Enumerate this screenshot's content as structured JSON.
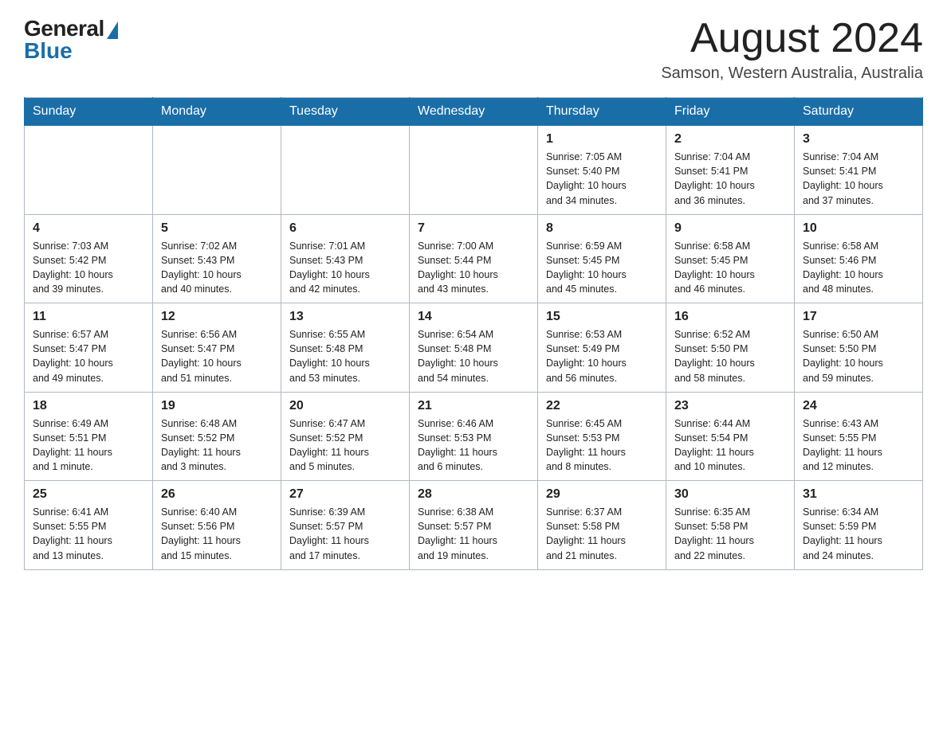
{
  "header": {
    "logo_general": "General",
    "logo_blue": "Blue",
    "month_year": "August 2024",
    "location": "Samson, Western Australia, Australia"
  },
  "days_of_week": [
    "Sunday",
    "Monday",
    "Tuesday",
    "Wednesday",
    "Thursday",
    "Friday",
    "Saturday"
  ],
  "weeks": [
    [
      {
        "day": "",
        "info": ""
      },
      {
        "day": "",
        "info": ""
      },
      {
        "day": "",
        "info": ""
      },
      {
        "day": "",
        "info": ""
      },
      {
        "day": "1",
        "info": "Sunrise: 7:05 AM\nSunset: 5:40 PM\nDaylight: 10 hours\nand 34 minutes."
      },
      {
        "day": "2",
        "info": "Sunrise: 7:04 AM\nSunset: 5:41 PM\nDaylight: 10 hours\nand 36 minutes."
      },
      {
        "day": "3",
        "info": "Sunrise: 7:04 AM\nSunset: 5:41 PM\nDaylight: 10 hours\nand 37 minutes."
      }
    ],
    [
      {
        "day": "4",
        "info": "Sunrise: 7:03 AM\nSunset: 5:42 PM\nDaylight: 10 hours\nand 39 minutes."
      },
      {
        "day": "5",
        "info": "Sunrise: 7:02 AM\nSunset: 5:43 PM\nDaylight: 10 hours\nand 40 minutes."
      },
      {
        "day": "6",
        "info": "Sunrise: 7:01 AM\nSunset: 5:43 PM\nDaylight: 10 hours\nand 42 minutes."
      },
      {
        "day": "7",
        "info": "Sunrise: 7:00 AM\nSunset: 5:44 PM\nDaylight: 10 hours\nand 43 minutes."
      },
      {
        "day": "8",
        "info": "Sunrise: 6:59 AM\nSunset: 5:45 PM\nDaylight: 10 hours\nand 45 minutes."
      },
      {
        "day": "9",
        "info": "Sunrise: 6:58 AM\nSunset: 5:45 PM\nDaylight: 10 hours\nand 46 minutes."
      },
      {
        "day": "10",
        "info": "Sunrise: 6:58 AM\nSunset: 5:46 PM\nDaylight: 10 hours\nand 48 minutes."
      }
    ],
    [
      {
        "day": "11",
        "info": "Sunrise: 6:57 AM\nSunset: 5:47 PM\nDaylight: 10 hours\nand 49 minutes."
      },
      {
        "day": "12",
        "info": "Sunrise: 6:56 AM\nSunset: 5:47 PM\nDaylight: 10 hours\nand 51 minutes."
      },
      {
        "day": "13",
        "info": "Sunrise: 6:55 AM\nSunset: 5:48 PM\nDaylight: 10 hours\nand 53 minutes."
      },
      {
        "day": "14",
        "info": "Sunrise: 6:54 AM\nSunset: 5:48 PM\nDaylight: 10 hours\nand 54 minutes."
      },
      {
        "day": "15",
        "info": "Sunrise: 6:53 AM\nSunset: 5:49 PM\nDaylight: 10 hours\nand 56 minutes."
      },
      {
        "day": "16",
        "info": "Sunrise: 6:52 AM\nSunset: 5:50 PM\nDaylight: 10 hours\nand 58 minutes."
      },
      {
        "day": "17",
        "info": "Sunrise: 6:50 AM\nSunset: 5:50 PM\nDaylight: 10 hours\nand 59 minutes."
      }
    ],
    [
      {
        "day": "18",
        "info": "Sunrise: 6:49 AM\nSunset: 5:51 PM\nDaylight: 11 hours\nand 1 minute."
      },
      {
        "day": "19",
        "info": "Sunrise: 6:48 AM\nSunset: 5:52 PM\nDaylight: 11 hours\nand 3 minutes."
      },
      {
        "day": "20",
        "info": "Sunrise: 6:47 AM\nSunset: 5:52 PM\nDaylight: 11 hours\nand 5 minutes."
      },
      {
        "day": "21",
        "info": "Sunrise: 6:46 AM\nSunset: 5:53 PM\nDaylight: 11 hours\nand 6 minutes."
      },
      {
        "day": "22",
        "info": "Sunrise: 6:45 AM\nSunset: 5:53 PM\nDaylight: 11 hours\nand 8 minutes."
      },
      {
        "day": "23",
        "info": "Sunrise: 6:44 AM\nSunset: 5:54 PM\nDaylight: 11 hours\nand 10 minutes."
      },
      {
        "day": "24",
        "info": "Sunrise: 6:43 AM\nSunset: 5:55 PM\nDaylight: 11 hours\nand 12 minutes."
      }
    ],
    [
      {
        "day": "25",
        "info": "Sunrise: 6:41 AM\nSunset: 5:55 PM\nDaylight: 11 hours\nand 13 minutes."
      },
      {
        "day": "26",
        "info": "Sunrise: 6:40 AM\nSunset: 5:56 PM\nDaylight: 11 hours\nand 15 minutes."
      },
      {
        "day": "27",
        "info": "Sunrise: 6:39 AM\nSunset: 5:57 PM\nDaylight: 11 hours\nand 17 minutes."
      },
      {
        "day": "28",
        "info": "Sunrise: 6:38 AM\nSunset: 5:57 PM\nDaylight: 11 hours\nand 19 minutes."
      },
      {
        "day": "29",
        "info": "Sunrise: 6:37 AM\nSunset: 5:58 PM\nDaylight: 11 hours\nand 21 minutes."
      },
      {
        "day": "30",
        "info": "Sunrise: 6:35 AM\nSunset: 5:58 PM\nDaylight: 11 hours\nand 22 minutes."
      },
      {
        "day": "31",
        "info": "Sunrise: 6:34 AM\nSunset: 5:59 PM\nDaylight: 11 hours\nand 24 minutes."
      }
    ]
  ]
}
